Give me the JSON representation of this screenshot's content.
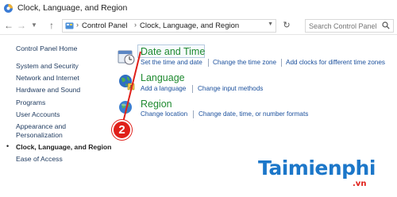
{
  "window": {
    "title": "Clock, Language, and Region"
  },
  "address": {
    "crumbs": [
      "Control Panel",
      "Clock, Language, and Region"
    ],
    "search_placeholder": "Search Control Panel"
  },
  "sidebar": {
    "items": [
      {
        "label": "Control Panel Home"
      },
      {
        "label": "System and Security"
      },
      {
        "label": "Network and Internet"
      },
      {
        "label": "Hardware and Sound"
      },
      {
        "label": "Programs"
      },
      {
        "label": "User Accounts"
      },
      {
        "label": "Appearance and"
      },
      {
        "label": "Personalization"
      },
      {
        "label": "Clock, Language, and Region"
      },
      {
        "label": "Ease of Access"
      }
    ],
    "active_bullet": "•"
  },
  "categories": {
    "datetime": {
      "title": "Date and Time",
      "links": [
        "Set the time and date",
        "Change the time zone",
        "Add clocks for different time zones"
      ]
    },
    "language": {
      "title": "Language",
      "links": [
        "Add a language",
        "Change input methods"
      ]
    },
    "region": {
      "title": "Region",
      "links": [
        "Change location",
        "Change date, time, or number formats"
      ]
    }
  },
  "annotation": {
    "step_number": "2"
  },
  "watermark": {
    "brand": "Taimienphi",
    "suffix": ".vn"
  },
  "colors": {
    "link": "#1a4f9c",
    "category_title": "#1f8a30",
    "badge": "#e0201a",
    "watermark": "#1c77c9"
  }
}
